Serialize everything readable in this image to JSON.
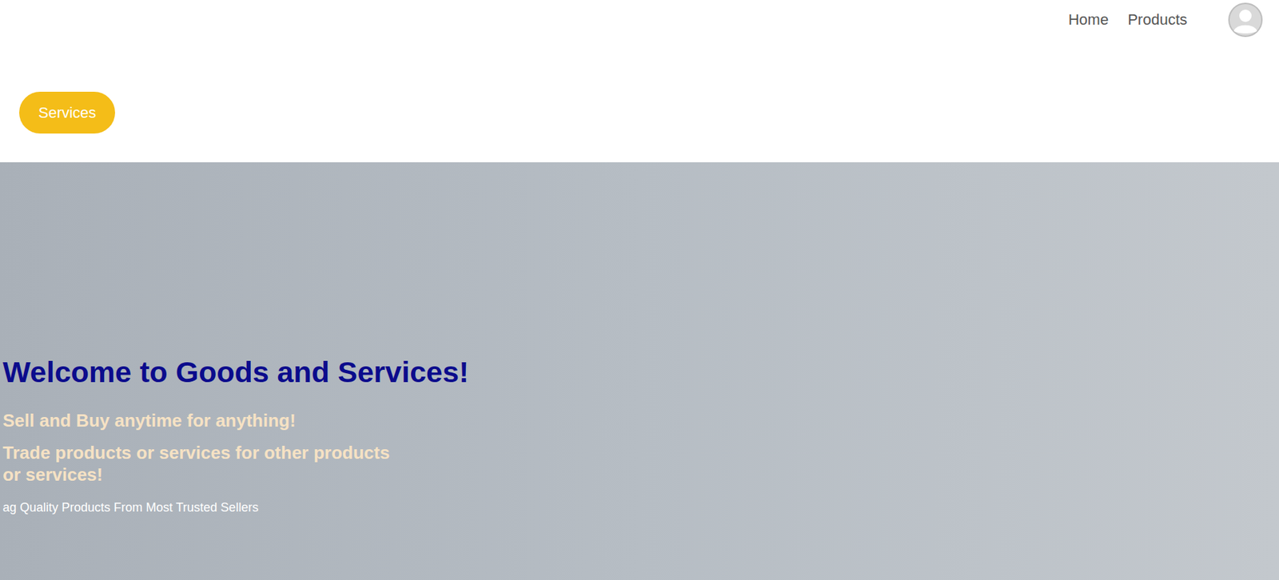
{
  "nav": {
    "items": [
      {
        "label": "Home"
      },
      {
        "label": "Products"
      }
    ]
  },
  "services_button": {
    "label": "Services"
  },
  "hero": {
    "title": "Welcome to Goods and Services!",
    "lines": [
      "Sell and Buy anytime for anything!",
      "Trade products or services for other products",
      "or services!"
    ],
    "tagline": "ag Quality Products From Most Trusted Sellers"
  }
}
